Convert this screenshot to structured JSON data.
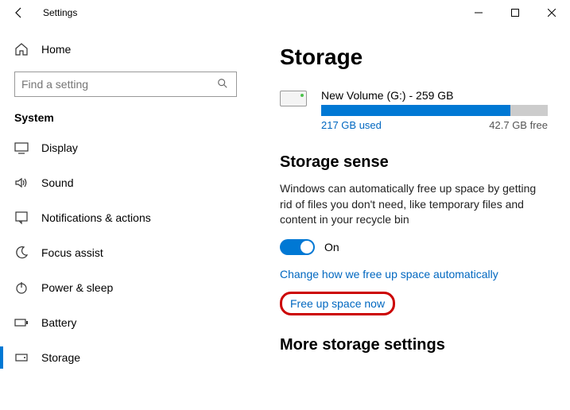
{
  "window": {
    "title": "Settings"
  },
  "sidebar": {
    "home_label": "Home",
    "search_placeholder": "Find a setting",
    "category": "System",
    "items": [
      {
        "label": "Display",
        "icon": "display"
      },
      {
        "label": "Sound",
        "icon": "sound"
      },
      {
        "label": "Notifications & actions",
        "icon": "notifications"
      },
      {
        "label": "Focus assist",
        "icon": "moon"
      },
      {
        "label": "Power & sleep",
        "icon": "power"
      },
      {
        "label": "Battery",
        "icon": "battery"
      },
      {
        "label": "Storage",
        "icon": "storage",
        "active": true
      }
    ]
  },
  "storage": {
    "page_title": "Storage",
    "volume": {
      "name": "New Volume (G:) - 259 GB",
      "used_label": "217 GB used",
      "free_label": "42.7 GB free",
      "used_percent": 83.5
    },
    "sense": {
      "title": "Storage sense",
      "description": "Windows can automatically free up space by getting rid of files you don't need, like temporary files and content in your recycle bin",
      "toggle_state": "On",
      "link_change": "Change how we free up space automatically",
      "link_freeup": "Free up space now"
    },
    "more_title": "More storage settings"
  }
}
